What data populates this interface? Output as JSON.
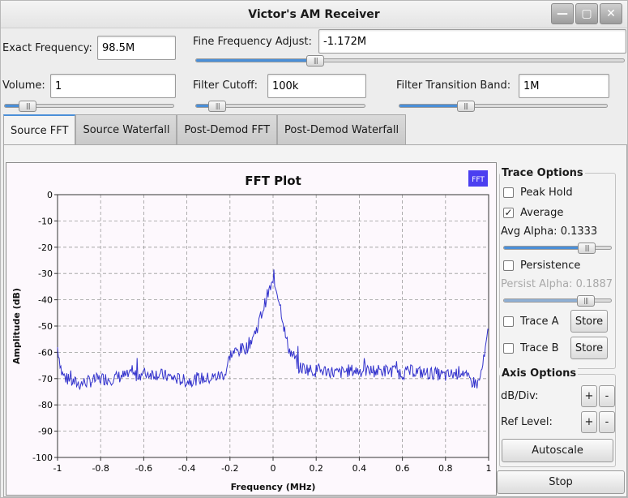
{
  "window": {
    "title": "Victor's AM Receiver",
    "buttons": {
      "minimize": "—",
      "maximize": "▢",
      "close": "✕"
    }
  },
  "controls": {
    "exact_frequency": {
      "label": "Exact Frequency:",
      "value": "98.5M"
    },
    "fine_frequency": {
      "label": "Fine Frequency Adjust:",
      "value": "-1.172M",
      "level": 0.28
    },
    "volume": {
      "label": "Volume:",
      "value": "1",
      "level": 0.14
    },
    "filter_cutoff": {
      "label": "Filter Cutoff:",
      "value": "100k",
      "level": 0.13
    },
    "transition_band": {
      "label": "Filter Transition Band:",
      "value": "1M",
      "level": 0.32
    }
  },
  "tabs": [
    "Source FFT",
    "Source Waterfall",
    "Post-Demod FFT",
    "Post-Demod Waterfall"
  ],
  "active_tab": 0,
  "trace_options": {
    "title": "Trace Options",
    "peak_hold": {
      "label": "Peak Hold",
      "checked": false
    },
    "average": {
      "label": "Average",
      "checked": true
    },
    "avg_alpha_label": "Avg Alpha:",
    "avg_alpha_value": "0.1333",
    "avg_alpha_level": 0.77,
    "persistence": {
      "label": "Persistence",
      "checked": false
    },
    "persist_alpha_label": "Persist Alpha:",
    "persist_alpha_value": "0.1887",
    "persist_alpha_level": 0.76,
    "trace_a": {
      "label": "Trace A",
      "checked": false
    },
    "trace_b": {
      "label": "Trace B",
      "checked": false
    },
    "store_label": "Store"
  },
  "axis_options": {
    "title": "Axis Options",
    "db_div_label": "dB/Div:",
    "ref_level_label": "Ref Level:",
    "plus": "+",
    "minus": "-",
    "autoscale": "Autoscale"
  },
  "stop_label": "Stop",
  "colors": {
    "trace": "#3333cc",
    "accent": "#4a8fd8",
    "legend": "#4b3ff0"
  },
  "chart_data": {
    "type": "line",
    "title": "FFT Plot",
    "xlabel": "Frequency (MHz)",
    "ylabel": "Amplitude (dB)",
    "xlim": [
      -1,
      1
    ],
    "ylim": [
      -100,
      0
    ],
    "x_ticks": [
      "-1",
      "-0.8",
      "-0.6",
      "-0.4",
      "-0.2",
      "0",
      "0.2",
      "0.4",
      "0.6",
      "0.8",
      "1"
    ],
    "y_ticks": [
      "0",
      "-10",
      "-20",
      "-30",
      "-40",
      "-50",
      "-60",
      "-70",
      "-80",
      "-90",
      "-100"
    ],
    "grid": true,
    "legend": {
      "label": "FFT",
      "placement": "top-right"
    },
    "series": [
      {
        "name": "FFT",
        "x": [
          -1.0,
          -0.98,
          -0.96,
          -0.94,
          -0.9,
          -0.85,
          -0.8,
          -0.75,
          -0.7,
          -0.65,
          -0.6,
          -0.55,
          -0.5,
          -0.45,
          -0.4,
          -0.35,
          -0.3,
          -0.25,
          -0.22,
          -0.2,
          -0.18,
          -0.15,
          -0.12,
          -0.1,
          -0.08,
          -0.06,
          -0.04,
          -0.03,
          -0.02,
          -0.01,
          0.0,
          0.01,
          0.02,
          0.03,
          0.04,
          0.05,
          0.06,
          0.08,
          0.1,
          0.12,
          0.15,
          0.18,
          0.2,
          0.25,
          0.3,
          0.35,
          0.4,
          0.45,
          0.5,
          0.55,
          0.6,
          0.65,
          0.7,
          0.75,
          0.8,
          0.85,
          0.88,
          0.9,
          0.92,
          0.95,
          0.96,
          0.98,
          1.0
        ],
        "y": [
          -58,
          -68,
          -70,
          -71,
          -72,
          -71,
          -70,
          -70,
          -69,
          -69,
          -68,
          -68,
          -69,
          -70,
          -71,
          -70,
          -70,
          -69,
          -68,
          -61,
          -60,
          -59,
          -58,
          -55,
          -52,
          -47,
          -42,
          -39,
          -37,
          -35,
          -34,
          -35,
          -37,
          -41,
          -45,
          -50,
          -55,
          -60,
          -62,
          -66,
          -66,
          -67,
          -67,
          -67,
          -68,
          -67,
          -67,
          -67,
          -67,
          -67,
          -68,
          -67,
          -68,
          -68,
          -69,
          -68,
          -67,
          -70,
          -71,
          -72,
          -70,
          -62,
          -51
        ]
      }
    ]
  }
}
